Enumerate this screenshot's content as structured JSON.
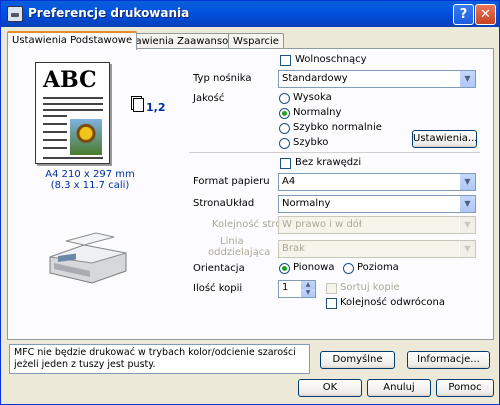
{
  "window": {
    "title": "Preferencje drukowania"
  },
  "tabs": [
    "Ustawienia Podstawowe",
    "Ustawienia Zaawansowane",
    "Wsparcie"
  ],
  "preview": {
    "sample_text": "ABC",
    "copies_label": "1,2",
    "paper_size_line1": "A4 210 x 297 mm",
    "paper_size_line2": "(8.3 x 11.7 cali)"
  },
  "settings": {
    "freeform_label": "Wolnoschnący",
    "media_type_label": "Typ nośnika",
    "media_type_value": "Standardowy",
    "quality_label": "Jakość",
    "quality_options": [
      "Wysoka",
      "Normalny",
      "Szybko normalnie",
      "Szybko"
    ],
    "quality_selected": "Normalny",
    "quality_settings_button": "Ustawienia...",
    "borderless_label": "Bez krawędzi",
    "paper_format_label": "Format papieru",
    "paper_format_value": "A4",
    "page_layout_label": "StronaUkład",
    "page_layout_value": "Normalny",
    "page_order_label": "Kolejność stron",
    "page_order_value": "W prawo i w dół",
    "border_line_label_1": "Linia",
    "border_line_label_2": "oddzielająca",
    "border_line_value": "Brak",
    "orientation_label": "Orientacja",
    "orientation_options": [
      "Pionowa",
      "Pozioma"
    ],
    "orientation_selected": "Pionowa",
    "copies_label": "Ilość kopii",
    "copies_value": "1",
    "collate_label": "Sortuj kopie",
    "reverse_order_label": "Kolejność odwrócona"
  },
  "status_message": "MFC nie będzie drukować w trybach kolor/odcienie szarości jeżeli jeden z tuszy jest pusty.",
  "buttons": {
    "defaults": "Domyślne",
    "info": "Informacje...",
    "ok": "OK",
    "cancel": "Anuluj",
    "help": "Pomoc"
  }
}
